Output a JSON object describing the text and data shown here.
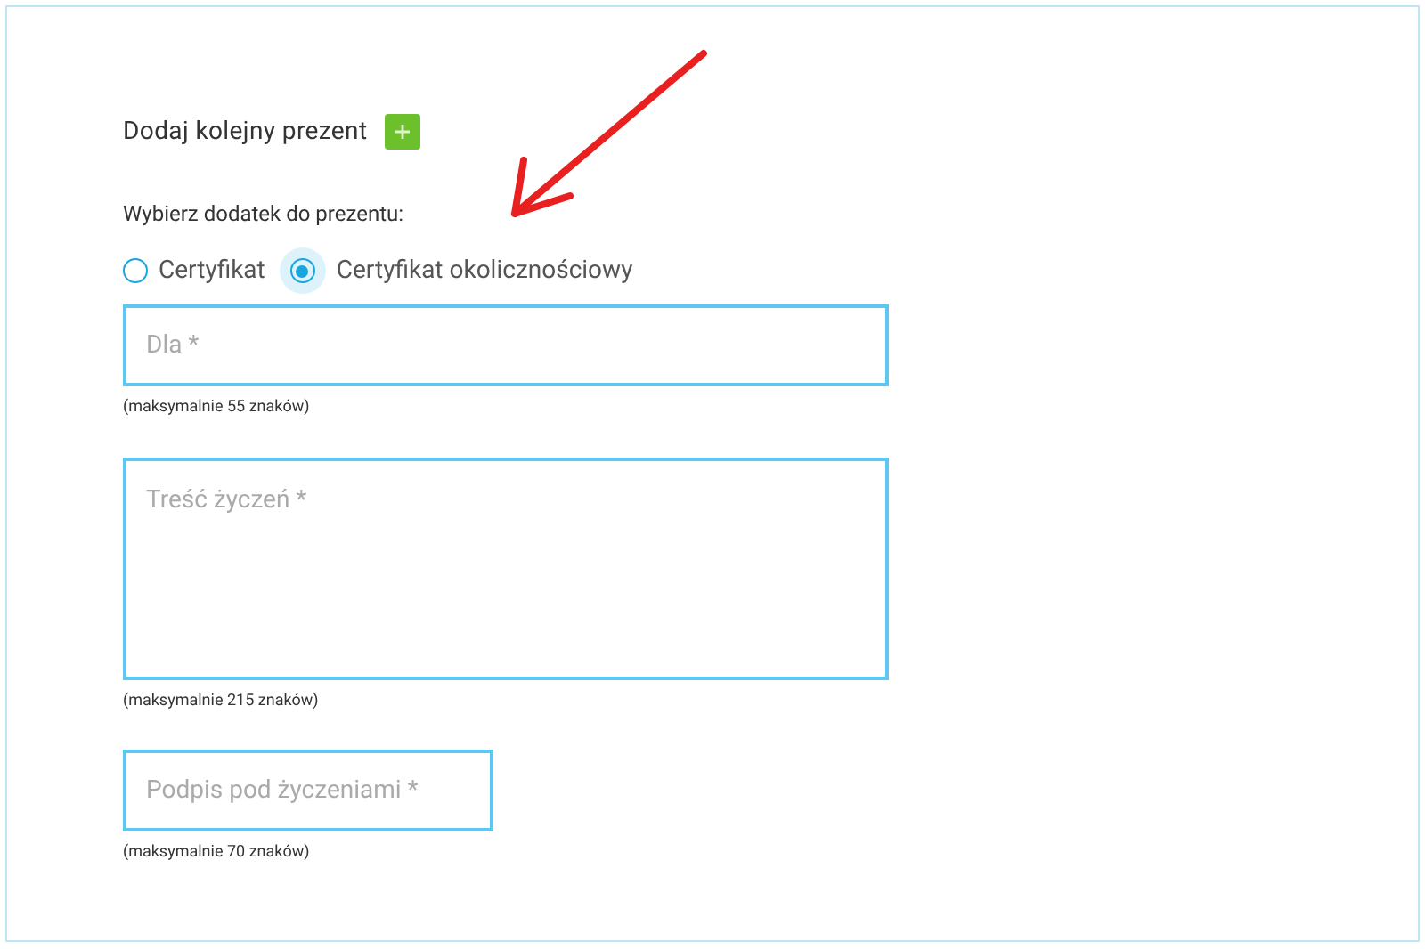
{
  "heading": "Dodaj kolejny prezent",
  "addon": {
    "label": "Wybierz dodatek do prezentu:",
    "options": [
      {
        "label": "Certyfikat",
        "selected": false
      },
      {
        "label": "Certyfikat okolicznościowy",
        "selected": true
      }
    ]
  },
  "fields": [
    {
      "kind": "input",
      "placeholder": "Dla *",
      "hint": "(maksymalnie 55 znaków)"
    },
    {
      "kind": "textarea",
      "placeholder": "Treść życzeń *",
      "hint": "(maksymalnie 215 znaków)"
    },
    {
      "kind": "short",
      "placeholder": "Podpis pod życzeniami *",
      "hint": "(maksymalnie 70 znaków)"
    }
  ]
}
